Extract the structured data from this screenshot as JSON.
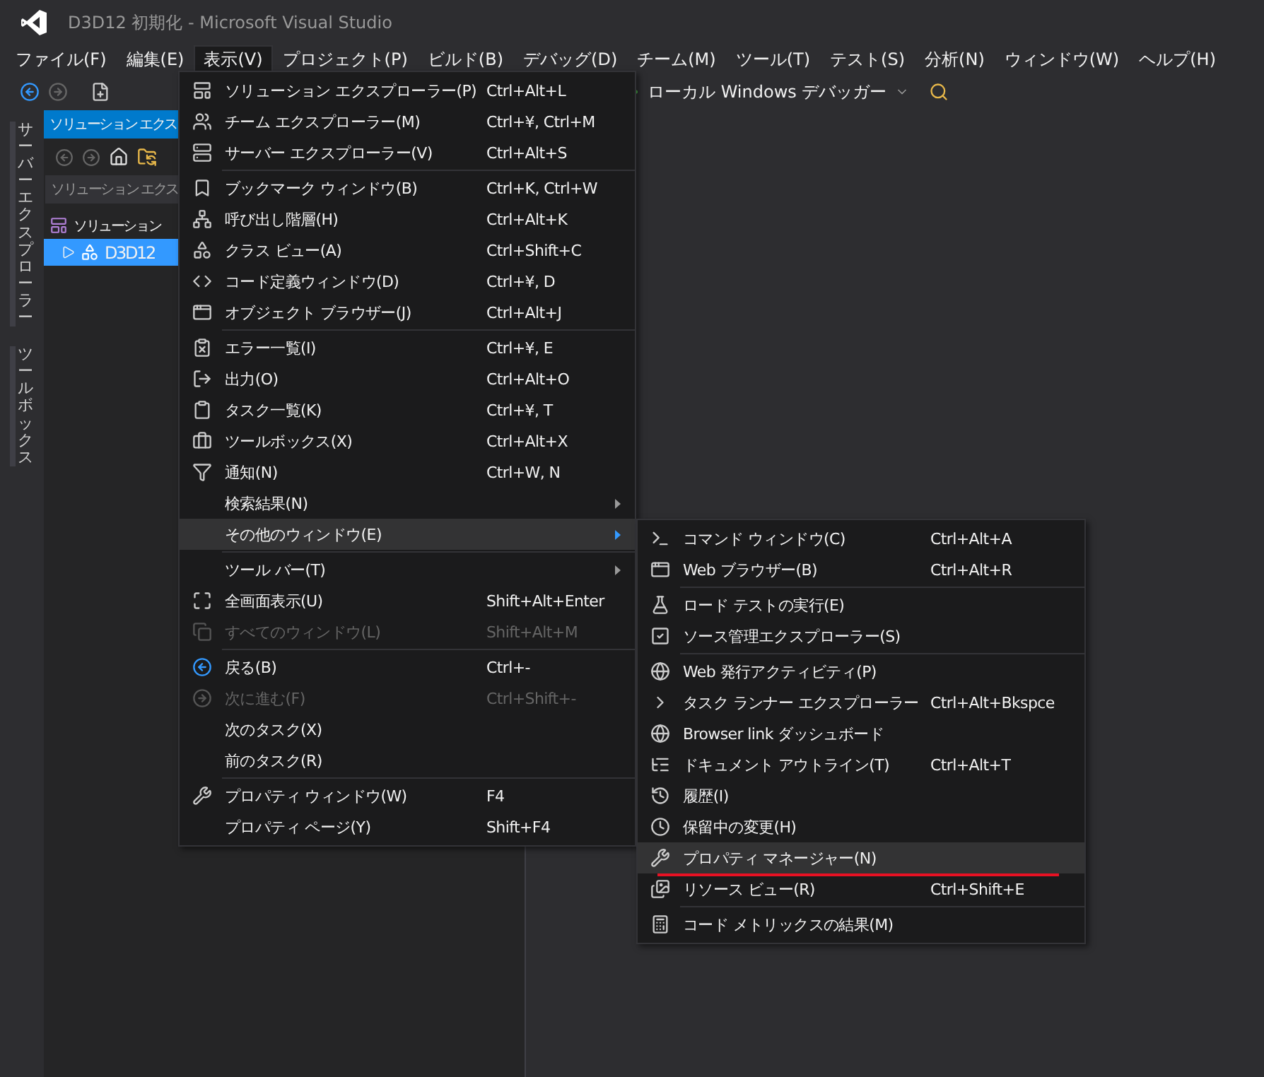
{
  "window": {
    "title": "D3D12 初期化 - Microsoft Visual Studio"
  },
  "menubar": [
    {
      "label": "ファイル(F)",
      "selected": false
    },
    {
      "label": "編集(E)",
      "selected": false
    },
    {
      "label": "表示(V)",
      "selected": true
    },
    {
      "label": "プロジェクト(P)",
      "selected": false
    },
    {
      "label": "ビルド(B)",
      "selected": false
    },
    {
      "label": "デバッグ(D)",
      "selected": false
    },
    {
      "label": "チーム(M)",
      "selected": false
    },
    {
      "label": "ツール(T)",
      "selected": false
    },
    {
      "label": "テスト(S)",
      "selected": false
    },
    {
      "label": "分析(N)",
      "selected": false
    },
    {
      "label": "ウィンドウ(W)",
      "selected": false
    },
    {
      "label": "ヘルプ(H)",
      "selected": false
    }
  ],
  "toolbar": {
    "debug_target": "ローカル Windows デバッガー"
  },
  "side_tabs": [
    "サーバーエクスプローラー",
    "ツールボックス"
  ],
  "solution_explorer": {
    "title": "ソリューション エクス",
    "search": {
      "placeholder": "ソリューション エクス"
    },
    "tree": [
      {
        "label": "ソリューション",
        "selected": false,
        "children": [
          {
            "label": "D3D12",
            "selected": true,
            "expanded": false
          }
        ]
      }
    ]
  },
  "view_menu": [
    {
      "kind": "item",
      "label": "ソリューション エクスプローラー(P)",
      "shortcut": "Ctrl+Alt+L",
      "disabled": false,
      "submenu": false,
      "selected": false
    },
    {
      "kind": "item",
      "label": "チーム エクスプローラー(M)",
      "shortcut": "Ctrl+¥, Ctrl+M",
      "disabled": false,
      "submenu": false,
      "selected": false
    },
    {
      "kind": "item",
      "label": "サーバー エクスプローラー(V)",
      "shortcut": "Ctrl+Alt+S",
      "disabled": false,
      "submenu": false,
      "selected": false
    },
    {
      "kind": "separator"
    },
    {
      "kind": "item",
      "label": "ブックマーク ウィンドウ(B)",
      "shortcut": "Ctrl+K, Ctrl+W",
      "disabled": false,
      "submenu": false,
      "selected": false
    },
    {
      "kind": "item",
      "label": "呼び出し階層(H)",
      "shortcut": "Ctrl+Alt+K",
      "disabled": false,
      "submenu": false,
      "selected": false
    },
    {
      "kind": "item",
      "label": "クラス ビュー(A)",
      "shortcut": "Ctrl+Shift+C",
      "disabled": false,
      "submenu": false,
      "selected": false
    },
    {
      "kind": "item",
      "label": "コード定義ウィンドウ(D)",
      "shortcut": "Ctrl+¥, D",
      "disabled": false,
      "submenu": false,
      "selected": false
    },
    {
      "kind": "item",
      "label": "オブジェクト ブラウザー(J)",
      "shortcut": "Ctrl+Alt+J",
      "disabled": false,
      "submenu": false,
      "selected": false
    },
    {
      "kind": "separator"
    },
    {
      "kind": "item",
      "label": "エラー一覧(I)",
      "shortcut": "Ctrl+¥, E",
      "disabled": false,
      "submenu": false,
      "selected": false
    },
    {
      "kind": "item",
      "label": "出力(O)",
      "shortcut": "Ctrl+Alt+O",
      "disabled": false,
      "submenu": false,
      "selected": false
    },
    {
      "kind": "item",
      "label": "タスク一覧(K)",
      "shortcut": "Ctrl+¥, T",
      "disabled": false,
      "submenu": false,
      "selected": false
    },
    {
      "kind": "item",
      "label": "ツールボックス(X)",
      "shortcut": "Ctrl+Alt+X",
      "disabled": false,
      "submenu": false,
      "selected": false
    },
    {
      "kind": "item",
      "label": "通知(N)",
      "shortcut": "Ctrl+W, N",
      "disabled": false,
      "submenu": false,
      "selected": false
    },
    {
      "kind": "item",
      "label": "検索結果(N)",
      "disabled": false,
      "submenu": true,
      "selected": false
    },
    {
      "kind": "item",
      "label": "その他のウィンドウ(E)",
      "disabled": false,
      "submenu": true,
      "selected": true
    },
    {
      "kind": "separator"
    },
    {
      "kind": "item",
      "label": "ツール バー(T)",
      "disabled": false,
      "submenu": true,
      "selected": false
    },
    {
      "kind": "item",
      "label": "全画面表示(U)",
      "shortcut": "Shift+Alt+Enter",
      "disabled": false,
      "submenu": false,
      "selected": false
    },
    {
      "kind": "item",
      "label": "すべてのウィンドウ(L)",
      "shortcut": "Shift+Alt+M",
      "disabled": true,
      "submenu": false,
      "selected": false
    },
    {
      "kind": "separator"
    },
    {
      "kind": "item",
      "label": "戻る(B)",
      "shortcut": "Ctrl+-",
      "disabled": false,
      "submenu": false,
      "selected": false
    },
    {
      "kind": "item",
      "label": "次に進む(F)",
      "shortcut": "Ctrl+Shift+-",
      "disabled": true,
      "submenu": false,
      "selected": false
    },
    {
      "kind": "item",
      "label": "次のタスク(X)",
      "disabled": false,
      "submenu": false,
      "selected": false
    },
    {
      "kind": "item",
      "label": "前のタスク(R)",
      "disabled": false,
      "submenu": false,
      "selected": false
    },
    {
      "kind": "separator"
    },
    {
      "kind": "item",
      "label": "プロパティ ウィンドウ(W)",
      "shortcut": "F4",
      "disabled": false,
      "submenu": false,
      "selected": false
    },
    {
      "kind": "item",
      "label": "プロパティ ページ(Y)",
      "shortcut": "Shift+F4",
      "disabled": false,
      "submenu": false,
      "selected": false
    }
  ],
  "other_windows_menu": [
    {
      "kind": "item",
      "label": "コマンド ウィンドウ(C)",
      "shortcut": "Ctrl+Alt+A",
      "selected": false
    },
    {
      "kind": "item",
      "label": "Web ブラウザー(B)",
      "shortcut": "Ctrl+Alt+R",
      "selected": false
    },
    {
      "kind": "separator"
    },
    {
      "kind": "item",
      "label": "ロード テストの実行(E)",
      "selected": false
    },
    {
      "kind": "item",
      "label": "ソース管理エクスプローラー(S)",
      "selected": false
    },
    {
      "kind": "separator"
    },
    {
      "kind": "item",
      "label": "Web 発行アクティビティ(P)",
      "selected": false
    },
    {
      "kind": "item",
      "label": "タスク ランナー エクスプローラー",
      "shortcut": "Ctrl+Alt+Bkspce",
      "selected": false
    },
    {
      "kind": "item",
      "label": "Browser link ダッシュボード",
      "selected": false
    },
    {
      "kind": "item",
      "label": "ドキュメント アウトライン(T)",
      "shortcut": "Ctrl+Alt+T",
      "selected": false
    },
    {
      "kind": "item",
      "label": "履歴(I)",
      "selected": false
    },
    {
      "kind": "item",
      "label": "保留中の変更(H)",
      "selected": false
    },
    {
      "kind": "item",
      "label": "プロパティ マネージャー(N)",
      "selected": true,
      "underlined": true
    },
    {
      "kind": "item",
      "label": "リソース ビュー(R)",
      "shortcut": "Ctrl+Shift+E",
      "selected": false
    },
    {
      "kind": "separator"
    },
    {
      "kind": "item",
      "label": "コード メトリックスの結果(M)",
      "selected": false
    }
  ]
}
